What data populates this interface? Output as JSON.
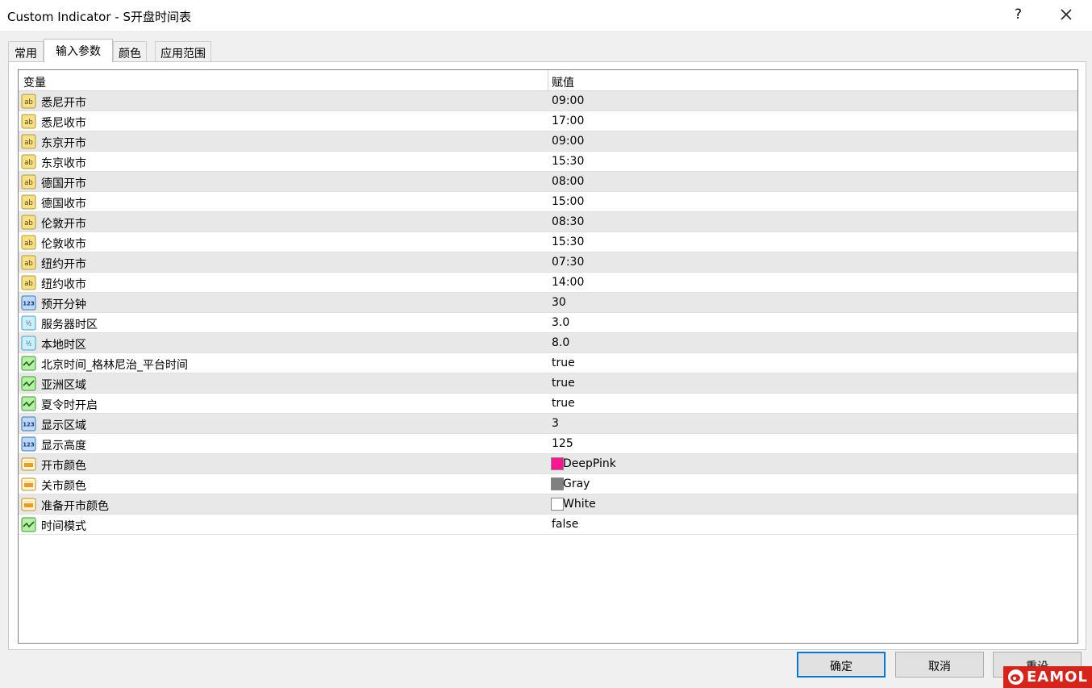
{
  "window": {
    "title": "Custom Indicator - S开盘时间表",
    "help_label": "?",
    "close_icon": "close-icon"
  },
  "tabs": [
    {
      "label": "常用",
      "active": false
    },
    {
      "label": "输入参数",
      "active": true
    },
    {
      "label": "颜色",
      "active": false
    },
    {
      "label": "应用范围",
      "active": false
    }
  ],
  "grid": {
    "columns": [
      "变量",
      "赋值"
    ],
    "rows": [
      {
        "icon": "ab",
        "name": "悉尼开市",
        "value": "09:00"
      },
      {
        "icon": "ab",
        "name": "悉尼收市",
        "value": "17:00"
      },
      {
        "icon": "ab",
        "name": "东京开市",
        "value": "09:00"
      },
      {
        "icon": "ab",
        "name": "东京收市",
        "value": "15:30"
      },
      {
        "icon": "ab",
        "name": "德国开市",
        "value": "08:00"
      },
      {
        "icon": "ab",
        "name": "德国收市",
        "value": "15:00"
      },
      {
        "icon": "ab",
        "name": "伦敦开市",
        "value": "08:30"
      },
      {
        "icon": "ab",
        "name": "伦敦收市",
        "value": "15:30"
      },
      {
        "icon": "ab",
        "name": "纽约开市",
        "value": "07:30"
      },
      {
        "icon": "ab",
        "name": "纽约收市",
        "value": "14:00"
      },
      {
        "icon": "123",
        "name": "预开分钟",
        "value": "30"
      },
      {
        "icon": "half",
        "name": "服务器时区",
        "value": "3.0"
      },
      {
        "icon": "half",
        "name": "本地时区",
        "value": "8.0"
      },
      {
        "icon": "bool",
        "name": "北京时间_格林尼治_平台时间",
        "value": "true"
      },
      {
        "icon": "bool",
        "name": "亚洲区域",
        "value": "true"
      },
      {
        "icon": "bool",
        "name": "夏令时开启",
        "value": "true"
      },
      {
        "icon": "123",
        "name": "显示区域",
        "value": "3"
      },
      {
        "icon": "123",
        "name": "显示高度",
        "value": "125"
      },
      {
        "icon": "color",
        "name": "开市颜色",
        "value": "DeepPink",
        "swatch": "#ff1493"
      },
      {
        "icon": "color",
        "name": "关市颜色",
        "value": "Gray",
        "swatch": "#808080"
      },
      {
        "icon": "color",
        "name": "准备开市颜色",
        "value": "White",
        "swatch": "#ffffff"
      },
      {
        "icon": "bool",
        "name": "时间模式",
        "value": "false"
      }
    ]
  },
  "buttons": {
    "ok": "确定",
    "cancel": "取消",
    "reset": "重设"
  },
  "watermark": {
    "text": "EAMOL"
  },
  "colors": {
    "accent": "#0078d7",
    "row_alt": "#e8e8e8"
  }
}
